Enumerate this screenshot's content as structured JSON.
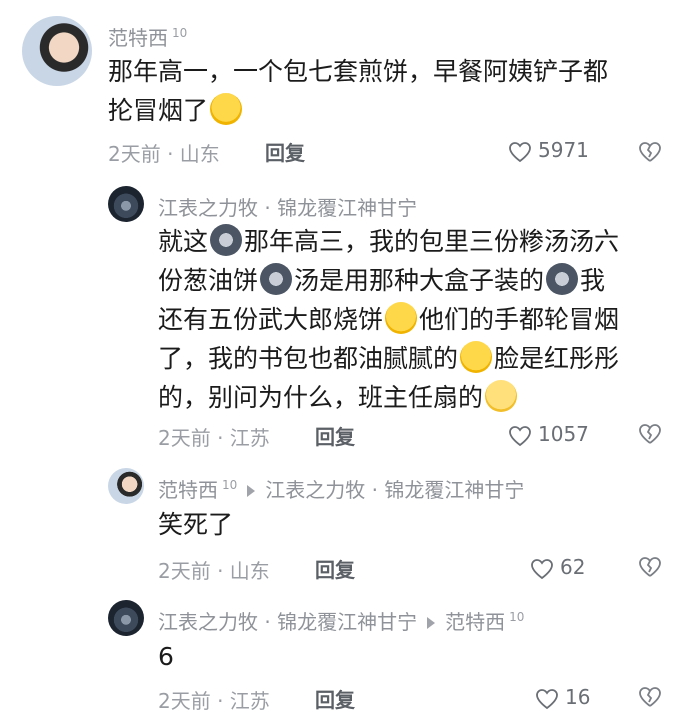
{
  "comments": [
    {
      "name": "范特西",
      "level": "10",
      "text_line1": "那年高一，一个包七套煎饼，早餐阿姨铲子都",
      "text_line2": "抡冒烟了",
      "emoji": "crying-face-icon",
      "meta": "2天前 · 山东",
      "reply": "回复",
      "likes": "5971"
    },
    {
      "name": "江表之力牧 · 锦龙覆江神甘宁",
      "text_lines": [
        [
          "就这",
          "dog-emoji-icon",
          "那年高三，我的包里三份糁汤汤六"
        ],
        [
          "份葱油饼",
          "dog-emoji-icon",
          "汤是用那种大盒子装的",
          "dog-emoji-icon",
          "我"
        ],
        [
          "还有五份武大郎烧饼",
          "laughing-crying-emoji-icon",
          "他们的手都轮冒烟"
        ],
        [
          "了，我的书包也都油腻腻的",
          "laughing-crying-emoji-icon",
          "脸是红彤彤"
        ],
        [
          "的，别问为什么，班主任扇的",
          "dizzy-face-emoji-icon"
        ]
      ],
      "meta": "2天前 · 江苏",
      "reply": "回复",
      "likes": "1057"
    },
    {
      "name": "范特西",
      "level": "10",
      "reply_to": "江表之力牧 · 锦龙覆江神甘宁",
      "text": "笑死了",
      "meta": "2天前 · 山东",
      "reply": "回复",
      "likes": "62"
    },
    {
      "name": "江表之力牧 · 锦龙覆江神甘宁",
      "reply_to": "范特西",
      "reply_to_level": "10",
      "text": "6",
      "meta": "2天前 · 江苏",
      "reply": "回复",
      "likes": "16"
    }
  ]
}
